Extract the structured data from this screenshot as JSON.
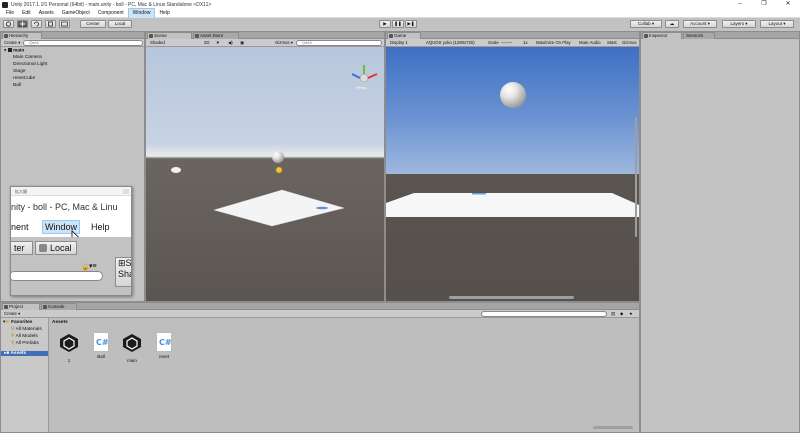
{
  "window": {
    "title": "Unity 2017.1.1f1 Personal (64bit) - main.unity - boll - PC, Mac & Linux Standalone <DX11>",
    "controls": [
      "–",
      "❐",
      "✕"
    ]
  },
  "menu": {
    "items": [
      "File",
      "Edit",
      "Assets",
      "GameObject",
      "Component",
      "Window",
      "Help"
    ],
    "active": "Window"
  },
  "toolbar": {
    "pivot_label": "Center",
    "space_label": "Local",
    "play": "▶",
    "pause": "❚❚",
    "step": "▶❚",
    "collab_label": "Collab ▾",
    "cloud_icon": "☁",
    "account_label": "Account ▾",
    "layers_label": "Layers ▾",
    "layout_label": "Layout ▾"
  },
  "hierarchy": {
    "tab": "Hierarchy",
    "create_label": "Create ▾",
    "search_placeholder": "Q▾All",
    "scene_name": "main",
    "items": [
      "Main Camera",
      "Directional Light",
      "Stage",
      "resetCube",
      "Ball"
    ]
  },
  "scene": {
    "tab": "Scene",
    "asset_store_tab": "Asset Store",
    "shading_label": "Shaded",
    "mode_2d": "2D",
    "gizmos_label": "Gizmos ▾",
    "search_placeholder": "Q▾All",
    "persp_label": "Persp"
  },
  "game": {
    "tab": "Game",
    "display_label": "Display 1",
    "resolution_label": "AQUOS yoko (1280x720)",
    "scale_label": "Scale",
    "scale_value": "1x",
    "maximize_label": "Maximize On Play",
    "mute_label": "Mute Audio",
    "stats_label": "Stats",
    "gizmos_label": "Gizmos"
  },
  "inspector": {
    "tab": "Inspector",
    "services_tab": "Services"
  },
  "zoom_popup": {
    "caption": "拡大鏡",
    "title_text": "nity - boll - PC, Mac & Linu",
    "menu_left": "nent",
    "menu_window": "Window",
    "menu_help": "Help",
    "btn_left": "ter",
    "btn_local": "Local",
    "btn_right_top": "S",
    "btn_right_bottom": "Sha"
  },
  "project": {
    "tab": "Project",
    "console_tab": "Console",
    "create_label": "Create ▾",
    "favorites_label": "Favorites",
    "favorites": [
      "All Materials",
      "All Models",
      "All Prefabs"
    ],
    "assets_root": "Assets",
    "breadcrumb": "Assets",
    "assets": [
      {
        "name": "1",
        "kind": "unity-scene"
      },
      {
        "name": "Ball",
        "kind": "csharp"
      },
      {
        "name": "main",
        "kind": "unity-scene"
      },
      {
        "name": "reset",
        "kind": "csharp"
      }
    ]
  },
  "colors": {
    "menu_highlight": "#cce4f7",
    "panel_bg": "#c2c2c2",
    "game_sky": "#3e6fc3",
    "selection_blue": "#3d6fb8"
  }
}
